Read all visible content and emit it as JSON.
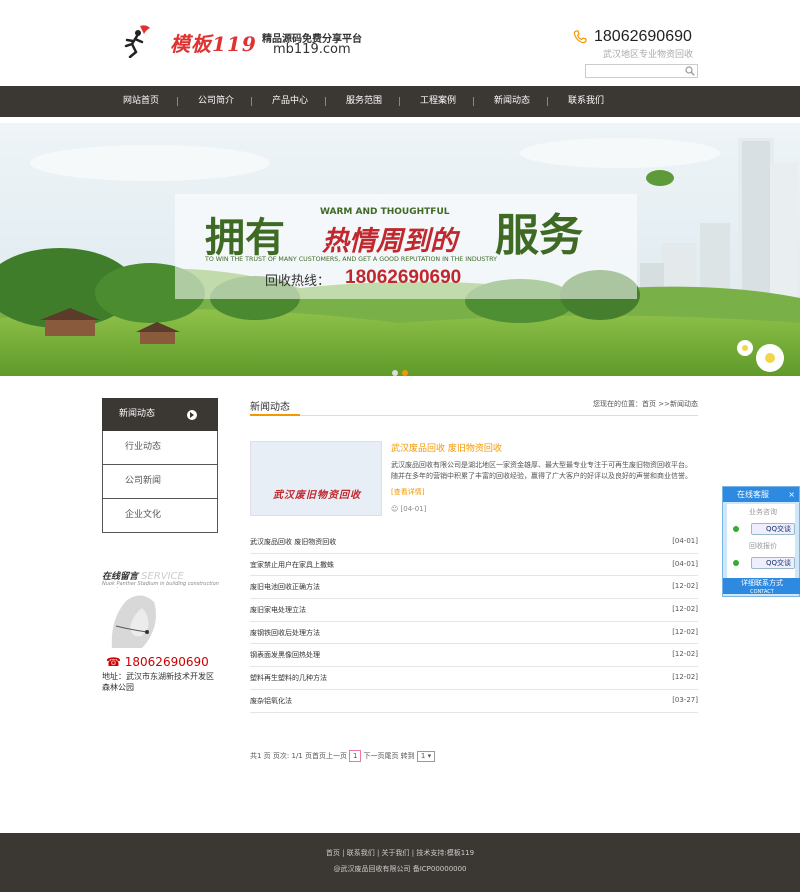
{
  "header": {
    "brand": "模板119",
    "slogan": "精品源码免费分享平台",
    "domain": "mb119.com",
    "phone": "18062690690",
    "phone_sub": "武汉地区专业物资回收",
    "search_placeholder": ""
  },
  "nav": {
    "items": [
      "网站首页",
      "公司简介",
      "产品中心",
      "服务范围",
      "工程案例",
      "新闻动态",
      "联系我们"
    ]
  },
  "banner": {
    "big_left": "拥有",
    "big_mid": "热情周到的",
    "big_right": "服务",
    "en_top": "WARM AND THOUGHTFUL",
    "en_line": "TO WIN THE TRUST OF MANY CUSTOMERS, AND GET A GOOD REPUTATION IN THE INDUSTRY",
    "hotline_label": "回收热线：",
    "hotline_num": "18062690690"
  },
  "sidebar": {
    "heading": "新闻动态",
    "items": [
      "行业动态",
      "公司新闻",
      "企业文化"
    ]
  },
  "service": {
    "title_cn": "在线留言",
    "title_en": "SERVICE",
    "tagline": "Nuok Panther Stadium in building construction expert",
    "tel": "18062690690",
    "address": "地址：武汉市东湖新技术开发区森林公园"
  },
  "main": {
    "title": "新闻动态",
    "breadcrumb": "您现在的位置：首页 >>新闻动态",
    "featured": {
      "image_text": "武汉废旧物资回收",
      "title": "武汉废品回收 废旧物资回收",
      "desc": "武汉废品回收有限公司是湖北地区一家资金雄厚、最大型最专业专注于可再生废旧物资回收平台。随并在多年的营销中积累了丰富的回收经验，赢得了广大客户的好评以及良好的声誉和商业信誉。",
      "more": "[查看详情]",
      "date": "[04-01]"
    },
    "list": [
      {
        "title": "武汉废品回收 废旧物资回收",
        "date": "[04-01]"
      },
      {
        "title": "宜家禁止用户在家具上撒蛛",
        "date": "[04-01]"
      },
      {
        "title": "废旧电池回收正确方法",
        "date": "[12-02]"
      },
      {
        "title": "废旧家电处理立法",
        "date": "[12-02]"
      },
      {
        "title": "废钢铁回收后处理方法",
        "date": "[12-02]"
      },
      {
        "title": "钢表面发黑像回热处理",
        "date": "[12-02]"
      },
      {
        "title": "塑料再生塑料的几种方法",
        "date": "[12-02]"
      },
      {
        "title": "废杂铝氧化法",
        "date": "[03-27]"
      }
    ],
    "pager": {
      "text_before": "共1 页 页次: 1/1 页首页上一页",
      "current": "1",
      "text_after": "下一页尾页 转到",
      "select": "1 ▾"
    }
  },
  "qq_panel": {
    "title": "在线客服",
    "close": "×",
    "label1": "业务咨询",
    "btn": "QQ交谈",
    "label2": "回收报价",
    "foot1": "详细联系方式",
    "foot2": "CONTACT"
  },
  "footer": {
    "links": "首页 | 联系我们 | 关于我们 | 技术支持:模板119",
    "copyright": "@武汉废品回收有限公司   备ICP00000000"
  },
  "colors": {
    "nav_bg": "#3b3733",
    "accent": "#f39800",
    "phone_red": "#c00"
  }
}
